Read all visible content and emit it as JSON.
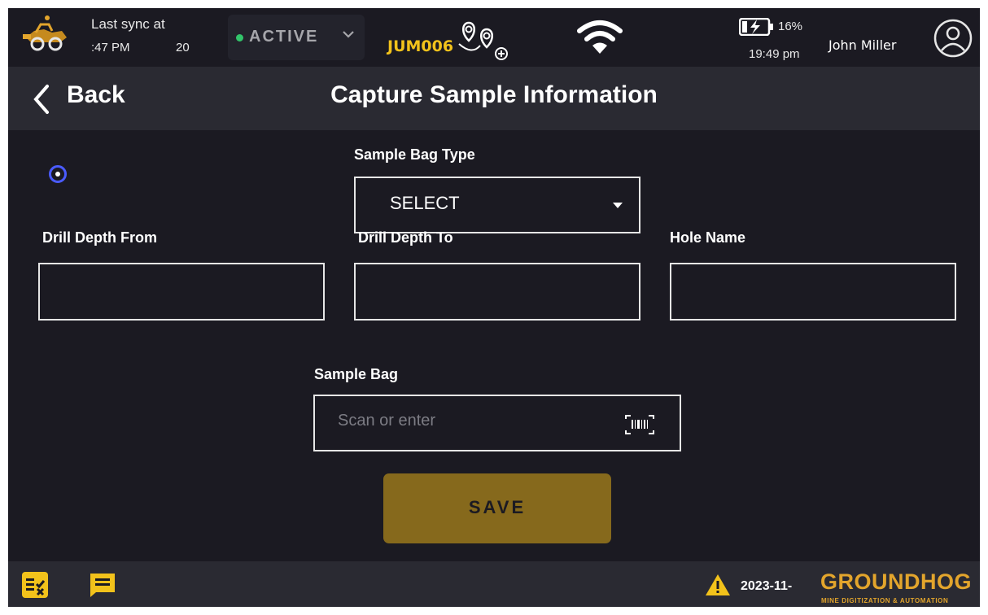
{
  "status_bar": {
    "sync_label": "Last sync at",
    "sync_time": ":47 PM",
    "sync_extra": "20",
    "connection_status": "ACTIVE",
    "device_id": "JUM006",
    "battery_percent": "16%",
    "clock": "19:49 pm",
    "user_name": "John Miller",
    "status_color": "#32c46a",
    "device_id_color": "#f2c21b"
  },
  "header": {
    "back_label": "Back",
    "title": "Capture Sample Information"
  },
  "form": {
    "sample_bag_type": {
      "label": "Sample Bag Type",
      "value": "SELECT"
    },
    "drill_depth_from": {
      "label": "Drill Depth From",
      "value": ""
    },
    "drill_depth_to": {
      "label": "Drill Depth To",
      "value": ""
    },
    "hole_name": {
      "label": "Hole Name",
      "value": ""
    },
    "sample_bag": {
      "label": "Sample Bag",
      "placeholder": "Scan or enter",
      "value": ""
    },
    "save_label": "SAVE",
    "save_color": "#86691c"
  },
  "footer": {
    "date": "2023-11-",
    "brand": "GROUNDHOG",
    "brand_tagline": "MINE DIGITIZATION & AUTOMATION",
    "brand_color": "#e3a52c",
    "icons": [
      "task-list-icon",
      "chat-icon",
      "warning-icon"
    ]
  }
}
